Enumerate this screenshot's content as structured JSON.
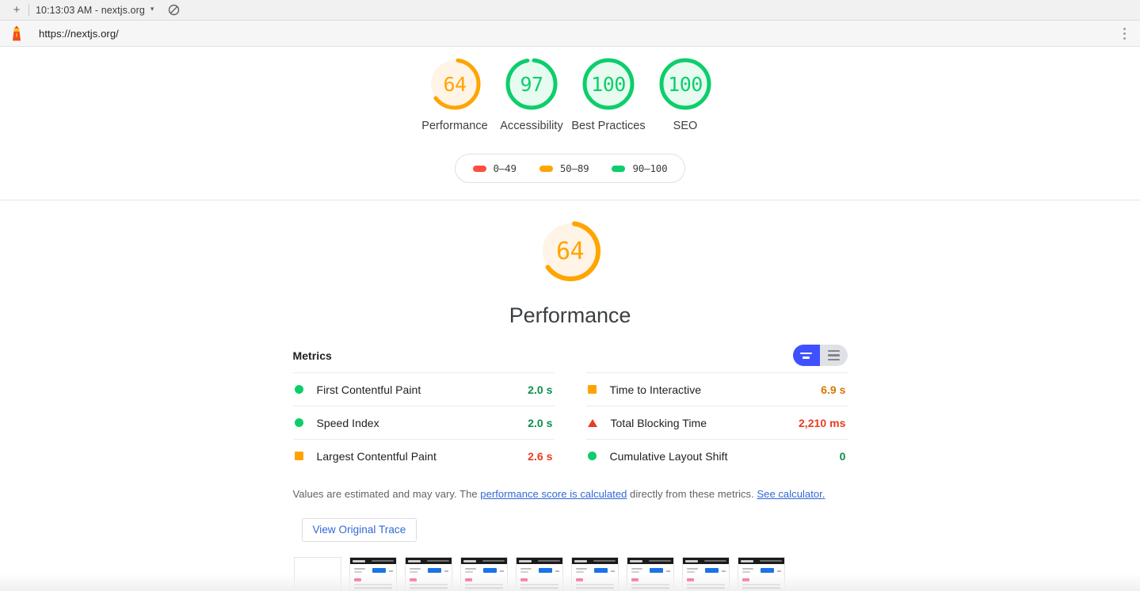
{
  "browser": {
    "new_tab_label": "+",
    "tab_title": "10:13:03 AM - nextjs.org",
    "tab_caret": "▾",
    "block_icon_name": "no-entry-icon",
    "url": "https://nextjs.org/",
    "menu_icon_name": "kebab-menu-icon"
  },
  "scores": {
    "categories": [
      {
        "label": "Performance",
        "value": "64",
        "score": 64,
        "rating": "average",
        "color": "#FFA400",
        "fill": "#FFF4E5"
      },
      {
        "label": "Accessibility",
        "value": "97",
        "score": 97,
        "rating": "pass",
        "color": "#0CCE6B",
        "fill": "#E8FBF1"
      },
      {
        "label": "Best Practices",
        "value": "100",
        "score": 100,
        "rating": "pass",
        "color": "#0CCE6B",
        "fill": "#E8FBF1"
      },
      {
        "label": "SEO",
        "value": "100",
        "score": 100,
        "rating": "pass",
        "color": "#0CCE6B",
        "fill": "#E8FBF1"
      }
    ],
    "legend": [
      {
        "range": "0–49",
        "color": "#FF4E42"
      },
      {
        "range": "50–89",
        "color": "#FFA400"
      },
      {
        "range": "90–100",
        "color": "#0CCE6B"
      }
    ]
  },
  "performance": {
    "score_value": "64",
    "score": 64,
    "title": "Performance",
    "color": "#FFA400",
    "fill": "#FFF4E5",
    "metrics_heading": "Metrics",
    "toggle": {
      "expand_label": "toggle-expanded-view",
      "collapse_label": "toggle-list-view"
    },
    "metrics": [
      {
        "name": "First Contentful Paint",
        "value": "2.0 s",
        "rating": "pass"
      },
      {
        "name": "Time to Interactive",
        "value": "6.9 s",
        "rating": "average"
      },
      {
        "name": "Speed Index",
        "value": "2.0 s",
        "rating": "pass"
      },
      {
        "name": "Total Blocking Time",
        "value": "2,210 ms",
        "rating": "fail"
      },
      {
        "name": "Largest Contentful Paint",
        "value": "2.6 s",
        "rating": "average"
      },
      {
        "name": "Cumulative Layout Shift",
        "value": "0",
        "rating": "pass"
      }
    ],
    "footnote": {
      "part1": "Values are estimated and may vary. The ",
      "link1": "performance score is calculated",
      "part2": " directly from these metrics. ",
      "link2": "See calculator."
    },
    "trace_button": "View Original Trace",
    "filmstrip_frames": 9
  }
}
